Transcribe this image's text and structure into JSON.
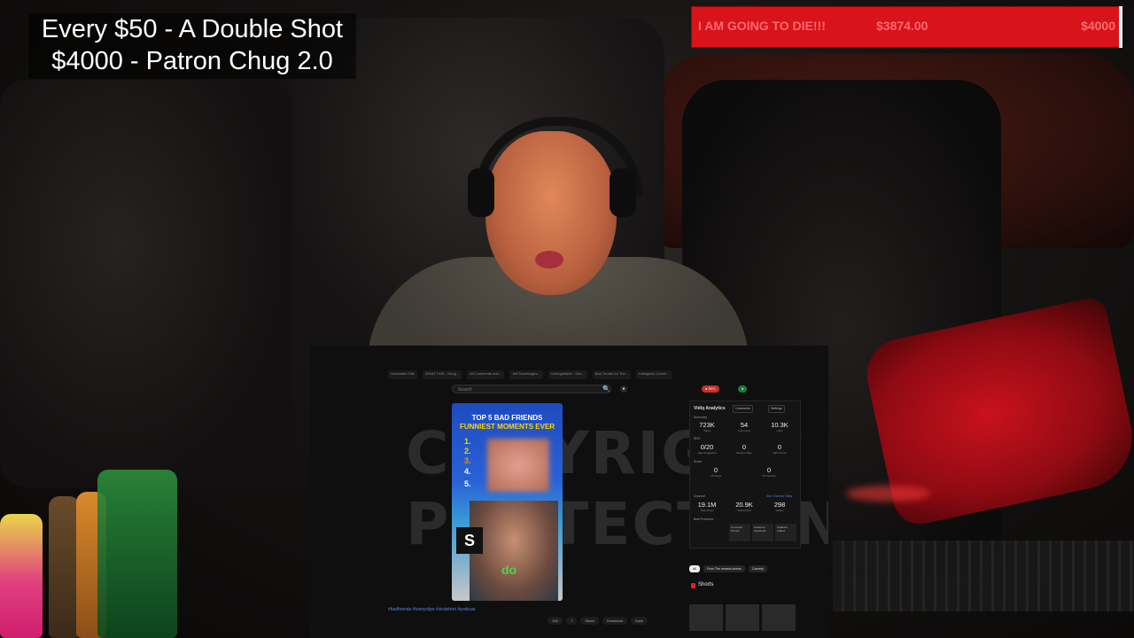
{
  "overlay_goals": {
    "line1": "Every $50 - A Double Shot",
    "line2": "$4000 - Patron Chug 2.0"
  },
  "donation_bar": {
    "title": "I AM GOING TO DIE!!!",
    "current": "$3874.00",
    "goal": "$4000",
    "progress_fraction": 0.9685,
    "color": "#d8131a"
  },
  "screen": {
    "tabs": [
      "Uncreated Title",
      "WHAT THIS - Goog...",
      "All Comments and...",
      "Jeff Dauntrages...",
      "Unforgettable - Sho...",
      "Bad Trends for The...",
      "Instagram Comm..."
    ],
    "search_placeholder": "Search",
    "watermark": [
      "COPYRIGHT",
      "PROTECTION"
    ],
    "short": {
      "title_line1": "TOP 5 BAD FRIENDS",
      "title_line2": "FUNNIEST MOMENTS EVER",
      "ranks": [
        "1.",
        "2.",
        "3.",
        "4.",
        "5."
      ],
      "logo": "S",
      "caption": "do"
    },
    "hashtags": "#badfriends #funnyclips #viralshort #podcast",
    "actions": [
      "10K",
      "7",
      "Share",
      "Download",
      "Save"
    ]
  },
  "analytics": {
    "header": "Vidiq Analytics",
    "buttons": [
      "Comments",
      "Settings"
    ],
    "summary_label": "Summary",
    "stats_row1": [
      {
        "value": "723K",
        "label": "Views"
      },
      {
        "value": "54",
        "label": "Comments"
      },
      {
        "value": "10.3K",
        "label": "Likes"
      }
    ],
    "seo_label": "SEO",
    "stats_row2": [
      {
        "value": "0/20",
        "label": "Tags Suggested"
      },
      {
        "value": "0",
        "label": "Ranked Tags"
      },
      {
        "value": "0",
        "label": "SEO Score"
      }
    ],
    "score_label": "Score",
    "stats_row3": [
      {
        "value": "0",
        "label": "VS Views"
      },
      {
        "value": "0",
        "label": "VS Velocity"
      }
    ],
    "channel_label": "Channel",
    "channel_link": "See Channel Stats",
    "stats_row4": [
      {
        "value": "19.1M",
        "label": "Total Views"
      },
      {
        "value": "20.9K",
        "label": "Subscribers"
      },
      {
        "value": "298",
        "label": "Videos"
      }
    ],
    "best_practices_label": "Best Practices",
    "cards": [
      "Comment Pinned",
      "Linked on Facebook",
      "Captions Added"
    ]
  },
  "related": {
    "chips": [
      "All",
      "From The nearest stories",
      "Comedy"
    ],
    "shorts_label": "Shorts"
  }
}
